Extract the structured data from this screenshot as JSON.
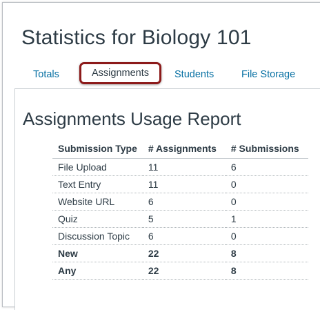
{
  "page_title": "Statistics for Biology 101",
  "tabs": [
    {
      "label": "Totals",
      "active": false
    },
    {
      "label": "Assignments",
      "active": true
    },
    {
      "label": "Students",
      "active": false
    },
    {
      "label": "File Storage",
      "active": false
    }
  ],
  "report_title": "Assignments Usage Report",
  "table": {
    "headers": [
      "Submission Type",
      "# Assignments",
      "# Submissions"
    ],
    "rows": [
      [
        "File Upload",
        "11",
        "6"
      ],
      [
        "Text Entry",
        "11",
        "0"
      ],
      [
        "Website URL",
        "6",
        "0"
      ],
      [
        "Quiz",
        "5",
        "1"
      ],
      [
        "Discussion Topic",
        "6",
        "0"
      ],
      [
        "New",
        "22",
        "8"
      ],
      [
        "Any",
        "22",
        "8"
      ]
    ]
  },
  "colors": {
    "link": "#0770a3",
    "text": "#2d3b45",
    "highlight_border": "#8c1a1a"
  }
}
